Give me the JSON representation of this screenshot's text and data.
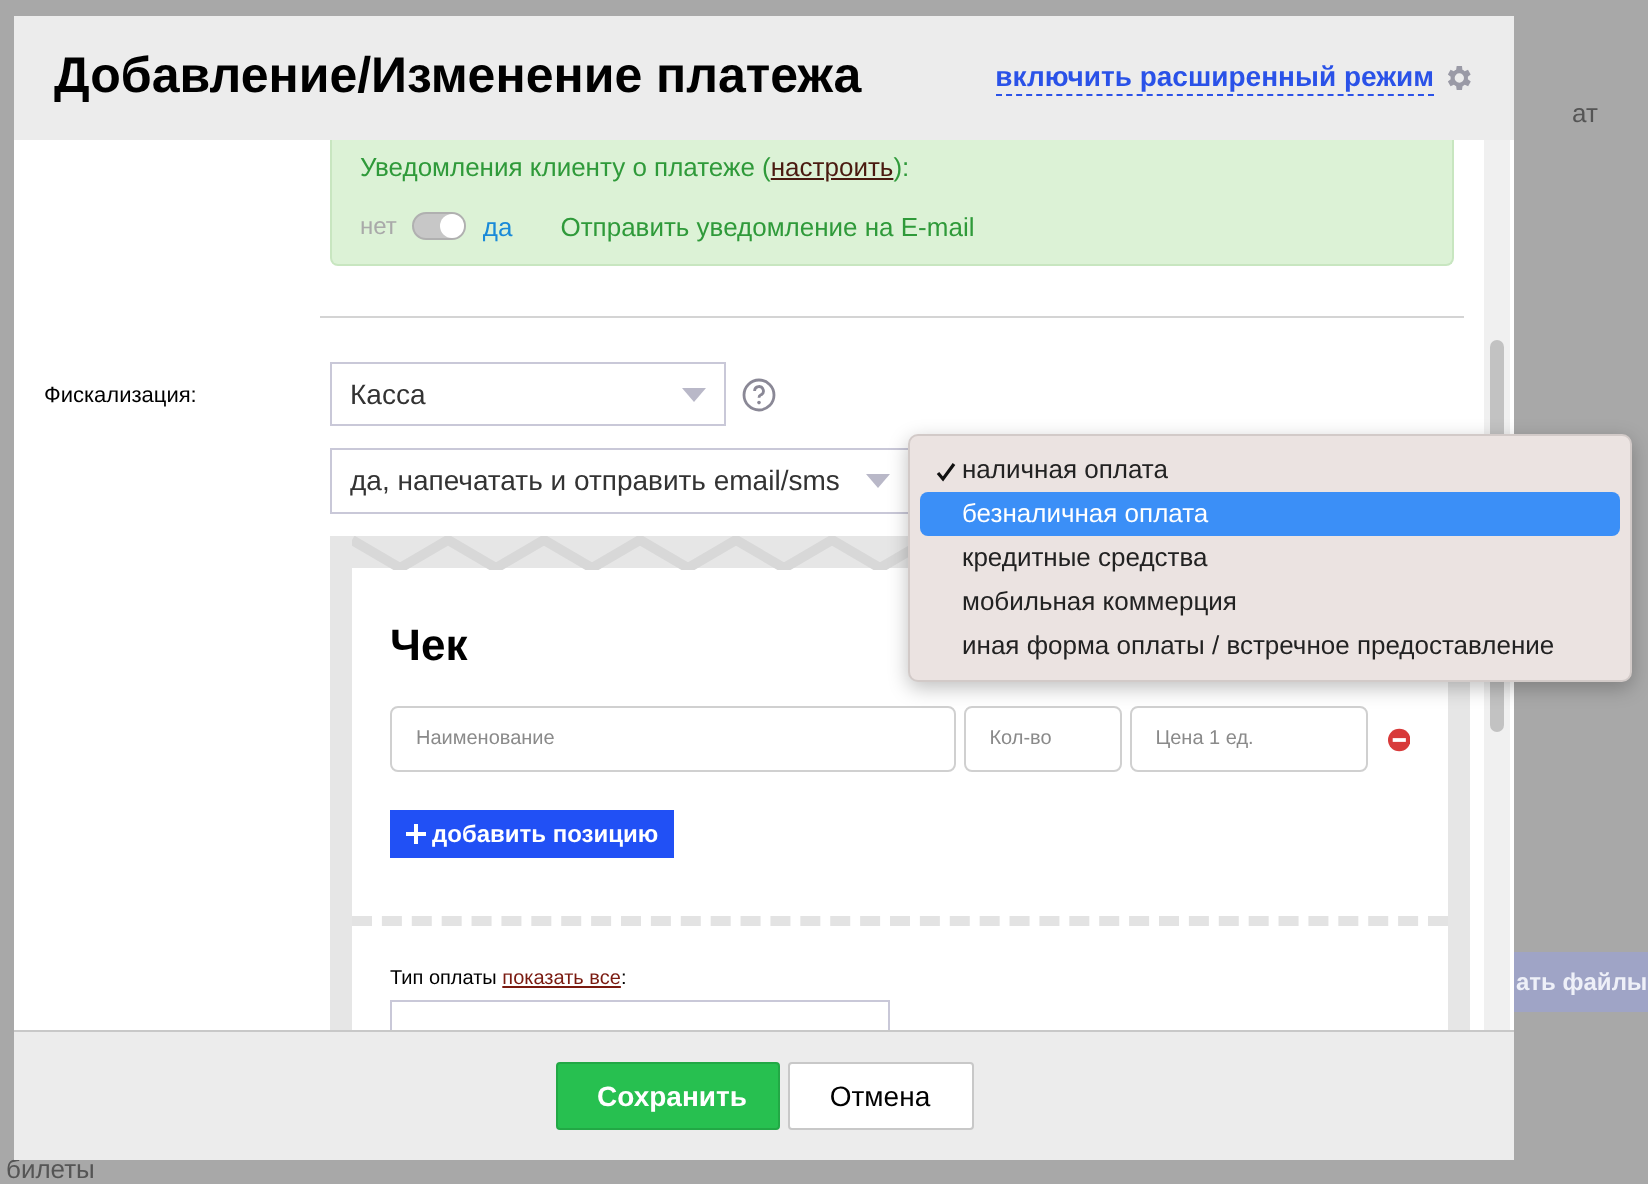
{
  "background": {
    "header_fragment": "ат",
    "upload_button": "ать файлы",
    "section_label": "билеты"
  },
  "dialog": {
    "title": "Добавление/Изменение платежа",
    "advanced_mode_link": "включить расширенный режим"
  },
  "notification": {
    "label_before": "Уведомления клиенту о платеже (",
    "configure_link": "настроить",
    "label_after": "):",
    "toggle_off_label": "нет",
    "toggle_on_label": "да",
    "on": true,
    "action": "Отправить уведомление на E-mail"
  },
  "fiscalization": {
    "label": "Фискализация:",
    "register_select": "Касса",
    "receipt_select": "да, напечатать и отправить email/sms"
  },
  "receipt": {
    "title": "Чек",
    "fields": [
      {
        "placeholder": "Наименование"
      },
      {
        "placeholder": "Кол-во"
      },
      {
        "placeholder": "Цена 1 ед."
      }
    ],
    "add_button": "добавить позицию",
    "payment_type_label": "Тип оплаты",
    "show_all_link": "показать все",
    "payment_type_colon": ":"
  },
  "payment_menu": [
    {
      "label": "наличная оплата",
      "checked": true,
      "selected": false
    },
    {
      "label": "безналичная оплата",
      "checked": false,
      "selected": true
    },
    {
      "label": "кредитные средства",
      "checked": false,
      "selected": false
    },
    {
      "label": "мобильная коммерция",
      "checked": false,
      "selected": false
    },
    {
      "label": "иная форма оплаты / встречное предоставление",
      "checked": false,
      "selected": false
    }
  ],
  "footer": {
    "buttons": [
      {
        "label": "Сохранить",
        "kind": "primary"
      },
      {
        "label": "Отмена",
        "kind": "secondary"
      }
    ]
  }
}
